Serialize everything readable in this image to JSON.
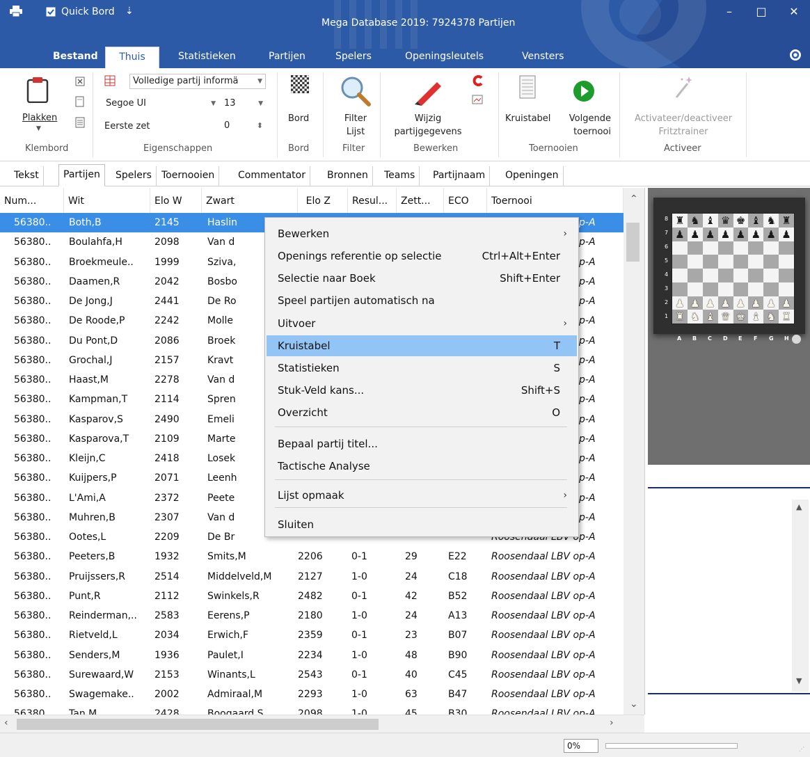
{
  "window": {
    "title": "Mega Database 2019:  7924378 Partijen",
    "qat_label": "Quick Bord",
    "qat_arrow": "⇣",
    "minimize": "–",
    "maximize": "□",
    "close": "✕"
  },
  "ribbon_tabs": [
    "Bestand",
    "Thuis",
    "Statistieken",
    "Partijen",
    "Spelers",
    "Openingsleutels",
    "Vensters"
  ],
  "ribbon": {
    "klembord": {
      "paste": "Plakken",
      "label": "Klembord"
    },
    "eigenschappen": {
      "info_combo": "Volledige partij informä",
      "font_combo": "Segoe UI",
      "size_combo": "13",
      "first_move_label": "Eerste zet",
      "first_move_value": "0",
      "label": "Eigenschappen"
    },
    "bord": {
      "button": "Bord",
      "label": "Bord"
    },
    "filter": {
      "button_line1": "Filter",
      "button_line2": "Lijst",
      "label": "Filter"
    },
    "bewerken": {
      "button_line1": "Wijzig",
      "button_line2": "partijgegevens",
      "label": "Bewerken"
    },
    "toernooien": {
      "crosstable": "Kruistabel",
      "next_line1": "Volgende",
      "next_line2": "toernooi",
      "label": "Toernooien"
    },
    "activeer": {
      "button_line1": "Activateer/deactiveer",
      "button_line2": "Fritztrainer",
      "label": "Activeer"
    }
  },
  "subtabs": [
    "Tekst",
    "Partijen",
    "Spelers",
    "Toernooien",
    "Commentator",
    "Bronnen",
    "Teams",
    "Partijnaam",
    "Openingen"
  ],
  "table": {
    "columns": [
      "Num...",
      "Wit",
      "Elo W",
      "Zwart",
      "Elo Z",
      "Resul...",
      "Zett...",
      "ECO",
      "Toernooi"
    ],
    "rows": [
      [
        "56380..",
        "Both,B",
        "2145",
        "Haslin",
        "",
        "",
        "",
        "",
        "Roosendaal LBV op-A"
      ],
      [
        "56380..",
        "Boulahfa,H",
        "2098",
        "Van d",
        "",
        "",
        "",
        "",
        "Roosendaal LBV op-A"
      ],
      [
        "56380..",
        "Broekmeule..",
        "1999",
        "Sziva,",
        "",
        "",
        "",
        "",
        "Roosendaal LBV op-A"
      ],
      [
        "56380..",
        "Daamen,R",
        "2042",
        "Bosbo",
        "",
        "",
        "",
        "",
        "Roosendaal LBV op-A"
      ],
      [
        "56380..",
        "De Jong,J",
        "2441",
        "De Ro",
        "",
        "",
        "",
        "",
        "Roosendaal LBV op-A"
      ],
      [
        "56380..",
        "De Roode,P",
        "2242",
        "Molle",
        "",
        "",
        "",
        "",
        "Roosendaal LBV op-A"
      ],
      [
        "56380..",
        "Du Pont,D",
        "2086",
        "Broek",
        "",
        "",
        "",
        "",
        "Roosendaal LBV op-A"
      ],
      [
        "56380..",
        "Grochal,J",
        "2157",
        "Kravt",
        "",
        "",
        "",
        "",
        "Roosendaal LBV op-A"
      ],
      [
        "56380..",
        "Haast,M",
        "2278",
        "Van d",
        "",
        "",
        "",
        "",
        "Roosendaal LBV op-A"
      ],
      [
        "56380..",
        "Kampman,T",
        "2114",
        "Spren",
        "",
        "",
        "",
        "",
        "Roosendaal LBV op-A"
      ],
      [
        "56380..",
        "Kasparov,S",
        "2490",
        "Emeli",
        "",
        "",
        "",
        "",
        "Roosendaal LBV op-A"
      ],
      [
        "56380..",
        "Kasparova,T",
        "2109",
        "Marte",
        "",
        "",
        "",
        "",
        "Roosendaal LBV op-A"
      ],
      [
        "56380..",
        "Kleijn,C",
        "2418",
        "Losek",
        "",
        "",
        "",
        "",
        "Roosendaal LBV op-A"
      ],
      [
        "56380..",
        "Kuijpers,P",
        "2071",
        "Leenh",
        "",
        "",
        "",
        "",
        "Roosendaal LBV op-A"
      ],
      [
        "56380..",
        "L'Ami,A",
        "2372",
        "Peete",
        "",
        "",
        "",
        "",
        "Roosendaal LBV op-A"
      ],
      [
        "56380..",
        "Muhren,B",
        "2307",
        "Van d",
        "",
        "",
        "",
        "",
        "Roosendaal LBV op-A"
      ],
      [
        "56380..",
        "Ootes,L",
        "2209",
        "De Br",
        "",
        "",
        "",
        "",
        "Roosendaal LBV op-A"
      ],
      [
        "56380..",
        "Peeters,B",
        "1932",
        "Smits,M",
        "2206",
        "0-1",
        "29",
        "E22",
        "Roosendaal LBV op-A"
      ],
      [
        "56380..",
        "Pruijssers,R",
        "2514",
        "Middelveld,M",
        "2127",
        "1-0",
        "24",
        "C18",
        "Roosendaal LBV op-A"
      ],
      [
        "56380..",
        "Punt,R",
        "2112",
        "Swinkels,R",
        "2482",
        "0-1",
        "42",
        "B52",
        "Roosendaal LBV op-A"
      ],
      [
        "56380..",
        "Reinderman,..",
        "2583",
        "Eerens,P",
        "2180",
        "1-0",
        "24",
        "A13",
        "Roosendaal LBV op-A"
      ],
      [
        "56380..",
        "Rietveld,L",
        "2034",
        "Erwich,F",
        "2359",
        "0-1",
        "23",
        "B07",
        "Roosendaal LBV op-A"
      ],
      [
        "56380..",
        "Senders,M",
        "1936",
        "Paulet,I",
        "2234",
        "1-0",
        "48",
        "B90",
        "Roosendaal LBV op-A"
      ],
      [
        "56380..",
        "Surewaard,W",
        "2153",
        "Winants,L",
        "2543",
        "0-1",
        "40",
        "C45",
        "Roosendaal LBV op-A"
      ],
      [
        "56380..",
        "Swagemake..",
        "2002",
        "Admiraal,M",
        "2293",
        "1-0",
        "63",
        "B47",
        "Roosendaal LBV op-A"
      ],
      [
        "56380..",
        "Tan,M",
        "2428",
        "Boogaard,S",
        "2098",
        "1-0",
        "45",
        "B30",
        "Roosendaal LBV op-A"
      ]
    ]
  },
  "context_menu": {
    "items": [
      {
        "label": "Bewerken",
        "shortcut": "",
        "submenu": true
      },
      {
        "label": "Openings referentie op selectie",
        "shortcut": "Ctrl+Alt+Enter",
        "submenu": false
      },
      {
        "label": "Selectie naar Boek",
        "shortcut": "Shift+Enter",
        "submenu": false
      },
      {
        "label": "Speel partijen automatisch na",
        "shortcut": "",
        "submenu": false
      },
      {
        "label": "Uitvoer",
        "shortcut": "",
        "submenu": true
      },
      {
        "label": "Kruistabel",
        "shortcut": "T",
        "submenu": false,
        "highlighted": true
      },
      {
        "label": "Statistieken",
        "shortcut": "S",
        "submenu": false
      },
      {
        "label": "Stuk-Veld kans...",
        "shortcut": "Shift+S",
        "submenu": false
      },
      {
        "label": "Overzicht",
        "shortcut": "O",
        "submenu": false
      },
      {
        "label": "Bepaal partij titel...",
        "shortcut": "",
        "submenu": false
      },
      {
        "label": "Tactische Analyse",
        "shortcut": "",
        "submenu": false
      },
      {
        "label": "Lijst opmaak",
        "shortcut": "",
        "submenu": true
      },
      {
        "label": "Sluiten",
        "shortcut": "",
        "submenu": false
      }
    ],
    "submenu_arrow": "›"
  },
  "board": {
    "ranks": [
      "8",
      "7",
      "6",
      "5",
      "4",
      "3",
      "2",
      "1"
    ],
    "files": [
      "A",
      "B",
      "C",
      "D",
      "E",
      "F",
      "G",
      "H"
    ],
    "position": [
      "♜♞♝♛♚♝♞♜",
      "♟♟♟♟♟♟♟♟",
      "........",
      "........",
      "........",
      "........",
      "PPPPPPPP",
      "RNBQKBNR"
    ]
  },
  "status": {
    "progress_text": "0%",
    "progress": 0
  },
  "colors": {
    "accent": "#2c5aa6",
    "selection": "#3a8ee6",
    "menu_highlight": "#92c5f5"
  }
}
